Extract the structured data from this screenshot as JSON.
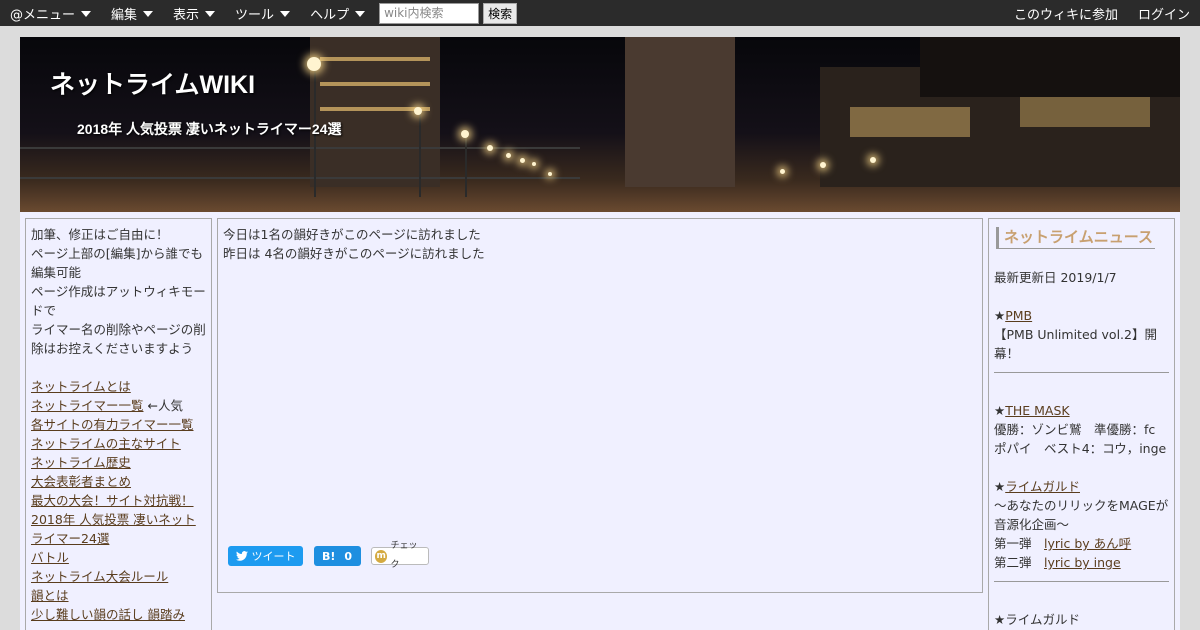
{
  "topbar": {
    "menus": [
      "@メニュー",
      "編集",
      "表示",
      "ツール",
      "ヘルプ"
    ],
    "search_placeholder": "wiki内検索",
    "search_button": "検索",
    "join": "このウィキに参加",
    "login": "ログイン"
  },
  "banner": {
    "title": "ネットライムWIKI",
    "subtitle": "2018年 人気投票 凄いネットライマー24選"
  },
  "left": {
    "intro": [
      "加筆、修正はご自由に！",
      "ページ上部の[編集]から誰でも編集可能",
      "ページ作成はアットウィキモードで",
      "ライマー名の削除やページの削除はお控えくださいますよう"
    ],
    "link_about": "ネットライムとは",
    "link_rhymer_list": "ネットライマー一覧",
    "popular_note": "←人気",
    "link_site_rhymers": "各サイトの有力ライマー一覧",
    "link_sites": "ネットライムの主なサイト",
    "link_history": "ネットライム歴史",
    "link_awards": "大会表彰者まとめ",
    "link_biggest": "最大の大会！サイト対抗戦！",
    "link_poll": "2018年 人気投票 凄いネットライマー24選",
    "link_battle": "バトル",
    "link_rules": "ネットライム大会ルール",
    "link_in": "韻とは",
    "link_more": "少し難しい韻の話し 韻踏み"
  },
  "center": {
    "today": "今日は1名の韻好きがこのページに訪れました",
    "yesterday": "昨日は 4名の韻好きがこのページに訪れました",
    "tweet": "ツイート",
    "hatena_label": "B!",
    "hatena_count": "0",
    "check": "チェック",
    "check_icon": "m"
  },
  "right": {
    "heading": "ネットライムニュース",
    "updated": "最新更新日 2019/1/7",
    "star": "★",
    "pmb": "PMB",
    "pmb_desc": "【PMB Unlimited vol.2】開幕！",
    "mask": "THE MASK",
    "mask_line1": "優勝：ゾンビ鷲　準優勝：fc",
    "mask_line2": "ポパイ　ベスト4：コウ，inge",
    "guild": "ライムガルド",
    "guild_desc": "～あなたのリリックをMAGEが音源化企画～",
    "first_label": "第一弾",
    "first_link": "lyric by あん呼",
    "second_label": "第二弾",
    "second_link": "lyric by inge",
    "guild2": "ライムガルド"
  }
}
